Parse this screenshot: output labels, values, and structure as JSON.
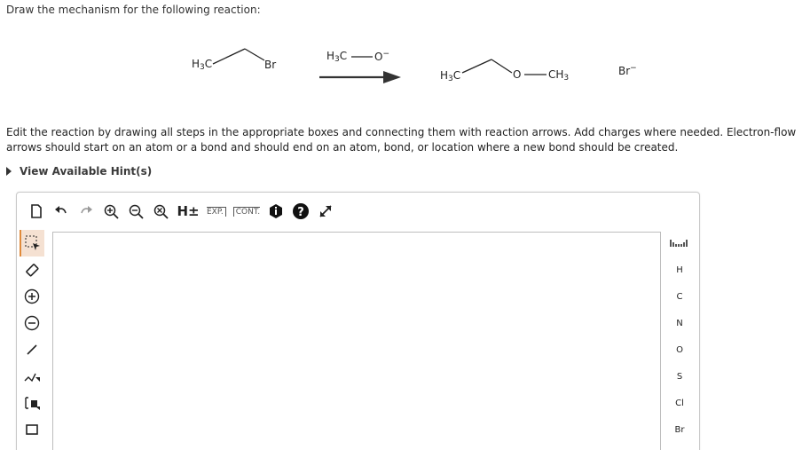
{
  "question": "Draw the mechanism for the following reaction:",
  "reaction": {
    "reactant1_left": "H3C",
    "reactant1_right": "Br",
    "reagent_left": "H3C",
    "reagent_right": "O",
    "reagent_charge": "−",
    "product_left": "H3C",
    "product_o": "O",
    "product_right": "CH3",
    "byproduct": "Br",
    "byproduct_charge": "−"
  },
  "instructions": "Edit the reaction by drawing all steps in the appropriate boxes and connecting them with reaction arrows. Add charges where needed. Electron-flow arrows should start on an atom or a bond and should end on an atom, bond, or location where a new bond should be created.",
  "hint_label": "View Available Hint(s)",
  "toolbar": {
    "hplus_label": "H±",
    "exp_label": "EXP.",
    "cont_label": "CONT."
  },
  "elements": [
    "H",
    "C",
    "N",
    "O",
    "S",
    "Cl",
    "Br"
  ],
  "colors": {
    "accent": "#e08a3a",
    "border": "#c9c9c9"
  }
}
